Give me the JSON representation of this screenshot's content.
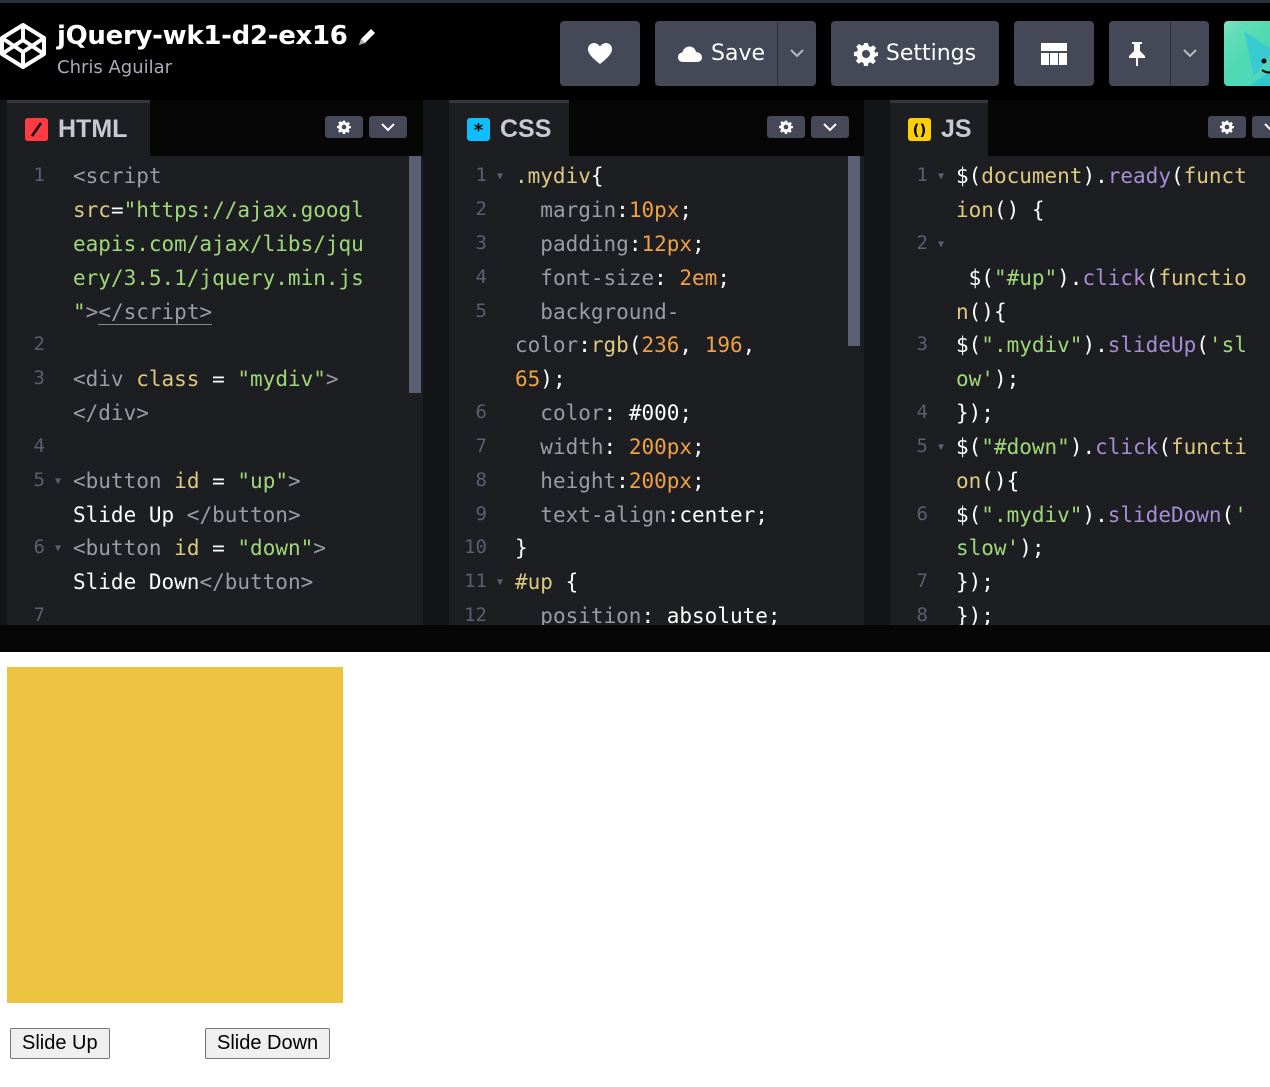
{
  "header": {
    "title": "jQuery-wk1-d2-ex16",
    "author": "Chris Aguilar",
    "save_label": "Save",
    "settings_label": "Settings"
  },
  "editors": {
    "html": {
      "label": "HTML"
    },
    "css": {
      "label": "CSS"
    },
    "js": {
      "label": "JS"
    }
  },
  "preview": {
    "box_color": "#ecc441",
    "slide_up_label": "Slide Up",
    "slide_down_label": "Slide Down"
  },
  "colors": {
    "header_bg": "#000000",
    "editor_bg": "#1d1e22",
    "button_bg": "#444857"
  },
  "icons": [
    "codepen-logo-icon",
    "pencil-icon",
    "heart-icon",
    "cloud-icon",
    "chevron-down-icon",
    "gear-icon",
    "layout-icon",
    "pin-icon",
    "avatar"
  ]
}
